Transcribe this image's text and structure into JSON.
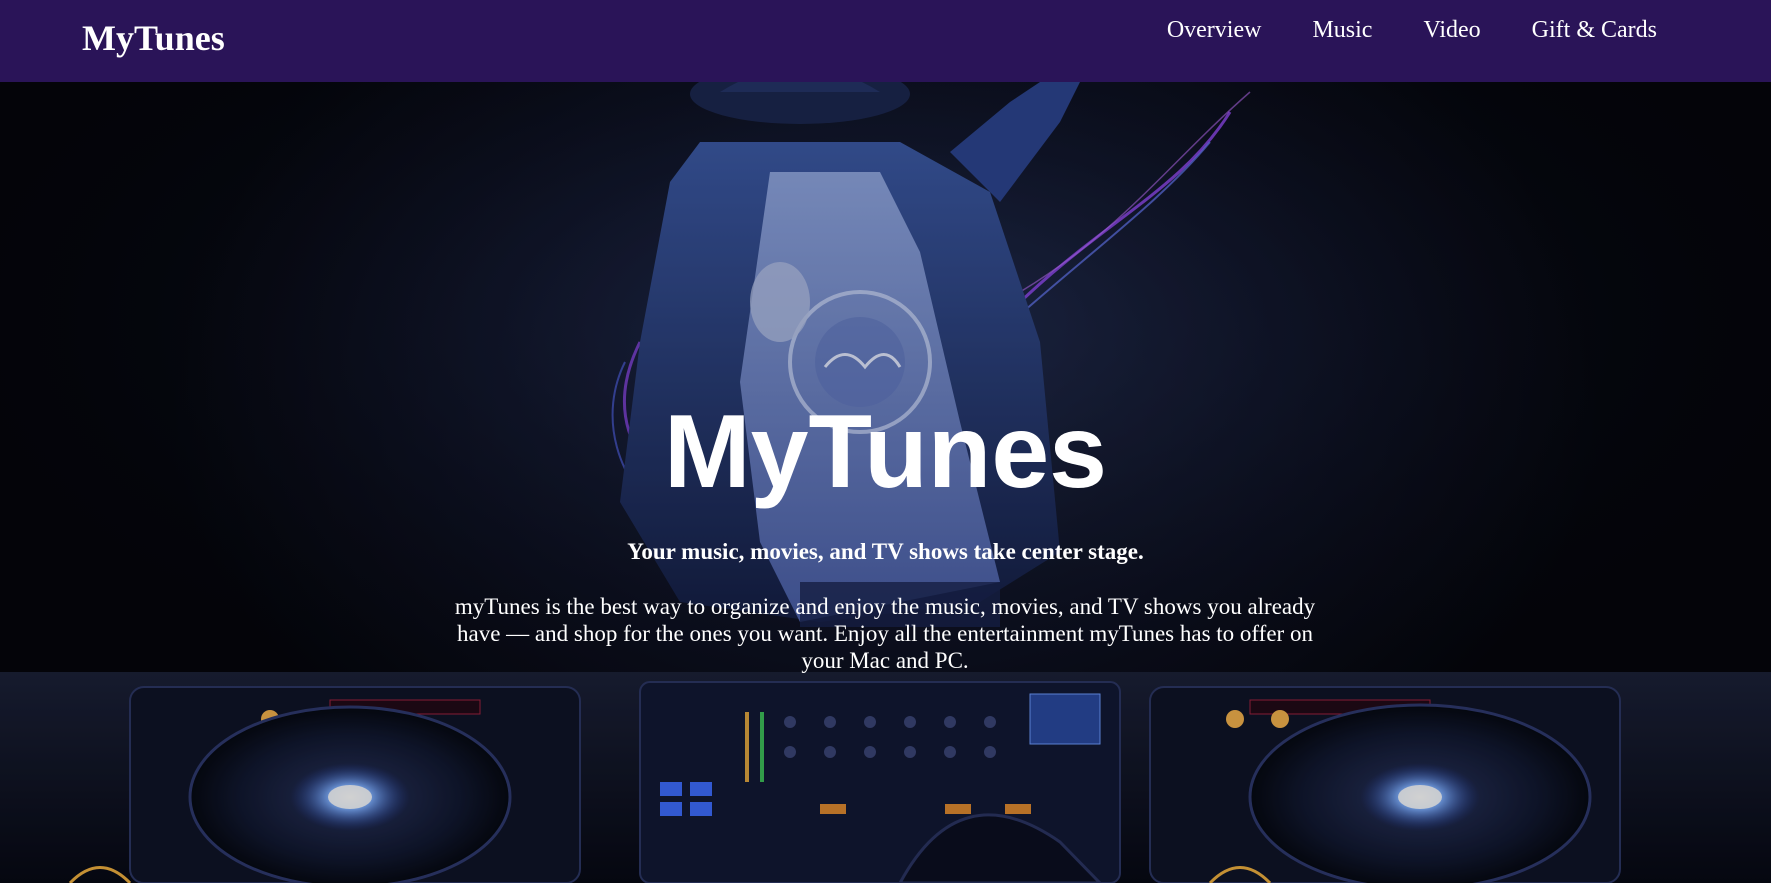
{
  "nav": {
    "brand": "MyTunes",
    "links": [
      "Overview",
      "Music",
      "Video",
      "Gift & Cards"
    ]
  },
  "hero": {
    "title": "MyTunes",
    "tagline": "Your music, movies, and TV shows take center stage.",
    "description": "myTunes is the best way to organize and enjoy the music, movies, and TV shows you already have — and shop for the ones you want. Enjoy all the entertainment myTunes has to offer on your Mac and PC.",
    "background_image": "dj-with-hat-at-turntables"
  },
  "colors": {
    "navbar": "#2a1458",
    "text": "#ffffff",
    "hero_dark": "#05060c",
    "accent_blue": "#3b6bff",
    "accent_purple": "#a040ff"
  }
}
